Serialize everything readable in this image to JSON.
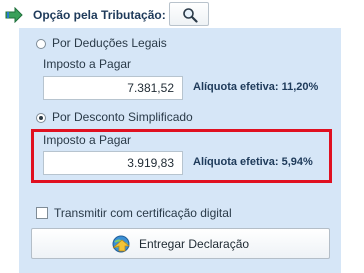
{
  "header": {
    "title": "Opção pela Tributação:",
    "icon": "green-arrow-icon",
    "search_icon": "magnifier-icon"
  },
  "option_legal": {
    "radio_label": "Por Deduções Legais",
    "selected": false,
    "field_label": "Imposto a Pagar",
    "value": "7.381,52",
    "aliquota": "Alíquota efetiva: 11,20%"
  },
  "option_simplified": {
    "radio_label": "Por Desconto Simplificado",
    "selected": true,
    "field_label": "Imposto a Pagar",
    "value": "3.919,83",
    "aliquota": "Alíquota efetiva: 5,94%"
  },
  "certificate": {
    "label": "Transmitir com certificação digital",
    "checked": false
  },
  "submit": {
    "label": "Entregar Declaração",
    "icon": "globe-upload-icon"
  },
  "colors": {
    "panel_bg": "#d6e6f7",
    "highlight": "#e01020",
    "title": "#1e3a5a"
  }
}
